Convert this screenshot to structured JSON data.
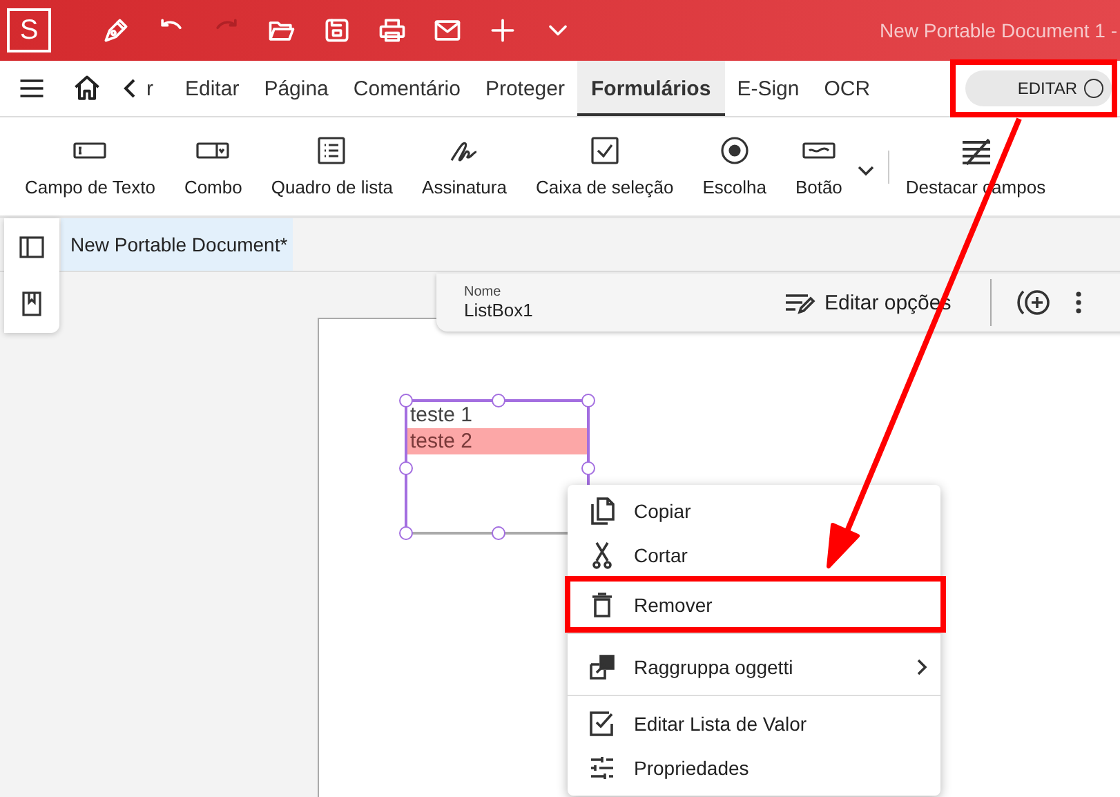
{
  "title_bar": {
    "logo": "S",
    "title": "New Portable Document 1 -",
    "tools": [
      {
        "kind": "pen",
        "disabled": false
      },
      {
        "kind": "undo",
        "disabled": false
      },
      {
        "kind": "redo",
        "disabled": true
      },
      {
        "kind": "folder",
        "disabled": false
      },
      {
        "kind": "save",
        "disabled": false
      },
      {
        "kind": "print",
        "disabled": false
      },
      {
        "kind": "mail",
        "disabled": false
      },
      {
        "kind": "plus",
        "disabled": false
      },
      {
        "kind": "chevron",
        "disabled": false
      }
    ]
  },
  "nav": {
    "cut_tab": "r",
    "tabs": [
      {
        "label": "Editar",
        "selected": false
      },
      {
        "label": "Página",
        "selected": false
      },
      {
        "label": "Comentário",
        "selected": false
      },
      {
        "label": "Proteger",
        "selected": false
      },
      {
        "label": "Formulários",
        "selected": true
      },
      {
        "label": "E-Sign",
        "selected": false
      },
      {
        "label": "OCR",
        "selected": false
      }
    ],
    "edit_toggle": {
      "label": "EDITAR",
      "on": false
    }
  },
  "toolbar": [
    {
      "kind": "text-field",
      "label": "Campo de Texto"
    },
    {
      "kind": "combo",
      "label": "Combo"
    },
    {
      "kind": "list",
      "label": "Quadro de lista"
    },
    {
      "kind": "signature",
      "label": "Assinatura"
    },
    {
      "kind": "checkbox",
      "label": "Caixa de seleção"
    },
    {
      "kind": "radio",
      "label": "Escolha"
    },
    {
      "kind": "button",
      "label": "Botão"
    },
    {
      "kind": "highlight",
      "label": "Destacar campos"
    }
  ],
  "document_tab": {
    "title": "New Portable Document*",
    "selected": true
  },
  "field_bar": {
    "name_label": "Nome",
    "name_value": "ListBox1",
    "edit_options": "Editar opções"
  },
  "listbox": {
    "items": [
      {
        "text": "teste 1",
        "selected": false
      },
      {
        "text": "teste 2",
        "selected": true
      }
    ]
  },
  "context_menu": [
    {
      "kind": "copy",
      "label": "Copiar",
      "submenu": false,
      "separator_after": false
    },
    {
      "kind": "cut",
      "label": "Cortar",
      "submenu": false,
      "separator_after": false
    },
    {
      "kind": "delete",
      "label": "Remover",
      "submenu": false,
      "separator_after": true
    },
    {
      "kind": "group",
      "label": "Raggruppa oggetti",
      "submenu": true,
      "separator_after": true
    },
    {
      "kind": "edit-list",
      "label": "Editar Lista de Valor",
      "submenu": false,
      "separator_after": false
    },
    {
      "kind": "properties",
      "label": "Propriedades",
      "submenu": false,
      "separator_after": false
    }
  ]
}
